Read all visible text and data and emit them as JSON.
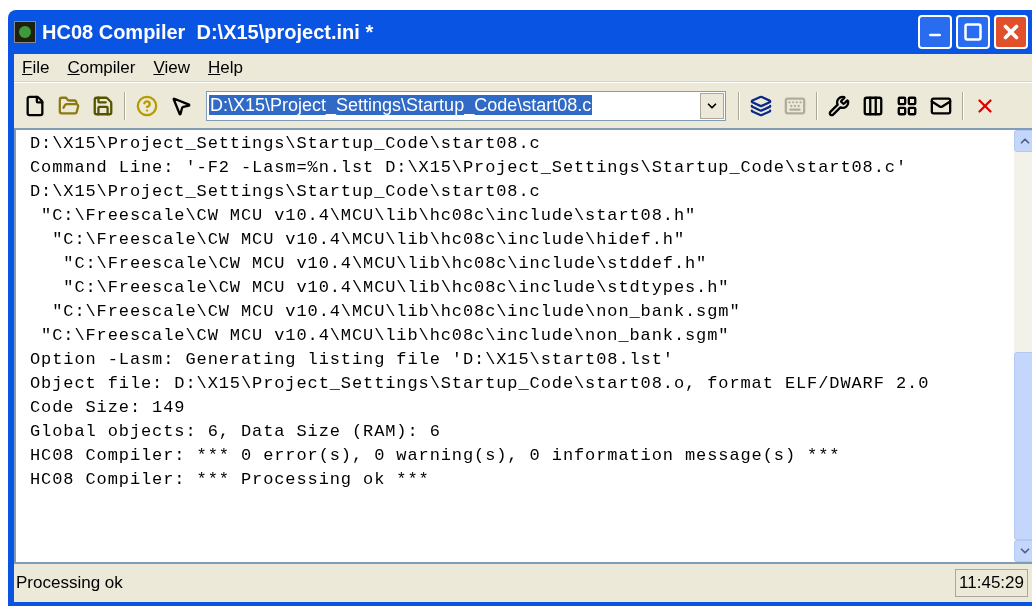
{
  "window": {
    "title": "HC08 Compiler  D:\\X15\\project.ini *"
  },
  "menu": [
    {
      "label": "File"
    },
    {
      "label": "Compiler"
    },
    {
      "label": "View"
    },
    {
      "label": "Help"
    }
  ],
  "toolbar": {
    "path_combo": {
      "value": "D:\\X15\\Project_Settings\\Startup_Code\\start08.c",
      "selected": true
    },
    "buttons": [
      {
        "kind": "new",
        "disabled": false
      },
      {
        "kind": "open",
        "disabled": false
      },
      {
        "kind": "save",
        "disabled": false
      },
      {
        "kind": "sep"
      },
      {
        "kind": "help",
        "disabled": false
      },
      {
        "kind": "context-help",
        "disabled": false
      },
      {
        "kind": "combo"
      },
      {
        "kind": "sep"
      },
      {
        "kind": "compile",
        "disabled": false
      },
      {
        "kind": "stop",
        "disabled": true
      },
      {
        "kind": "sep"
      },
      {
        "kind": "options",
        "disabled": false
      },
      {
        "kind": "bars",
        "disabled": false
      },
      {
        "kind": "grid",
        "disabled": false
      },
      {
        "kind": "mail",
        "disabled": false
      },
      {
        "kind": "sep"
      },
      {
        "kind": "close-x",
        "disabled": false
      }
    ]
  },
  "output": [
    "D:\\X15\\Project_Settings\\Startup_Code\\start08.c",
    "Command Line: '-F2 -Lasm=%n.lst D:\\X15\\Project_Settings\\Startup_Code\\start08.c'",
    "D:\\X15\\Project_Settings\\Startup_Code\\start08.c",
    " \"C:\\Freescale\\CW MCU v10.4\\MCU\\lib\\hc08c\\include\\start08.h\"",
    "  \"C:\\Freescale\\CW MCU v10.4\\MCU\\lib\\hc08c\\include\\hidef.h\"",
    "   \"C:\\Freescale\\CW MCU v10.4\\MCU\\lib\\hc08c\\include\\stddef.h\"",
    "   \"C:\\Freescale\\CW MCU v10.4\\MCU\\lib\\hc08c\\include\\stdtypes.h\"",
    "  \"C:\\Freescale\\CW MCU v10.4\\MCU\\lib\\hc08c\\include\\non_bank.sgm\"",
    " \"C:\\Freescale\\CW MCU v10.4\\MCU\\lib\\hc08c\\include\\non_bank.sgm\"",
    "Option -Lasm: Generating listing file 'D:\\X15\\start08.lst'",
    "Object file: D:\\X15\\Project_Settings\\Startup_Code\\start08.o, format ELF/DWARF 2.0",
    "Code Size: 149",
    "Global objects: 6, Data Size (RAM): 6",
    "HC08 Compiler: *** 0 error(s), 0 warning(s), 0 information message(s) ***",
    "HC08 Compiler: *** Processing ok ***"
  ],
  "status_bar": {
    "message": "Processing ok",
    "time": "11:45:29"
  }
}
